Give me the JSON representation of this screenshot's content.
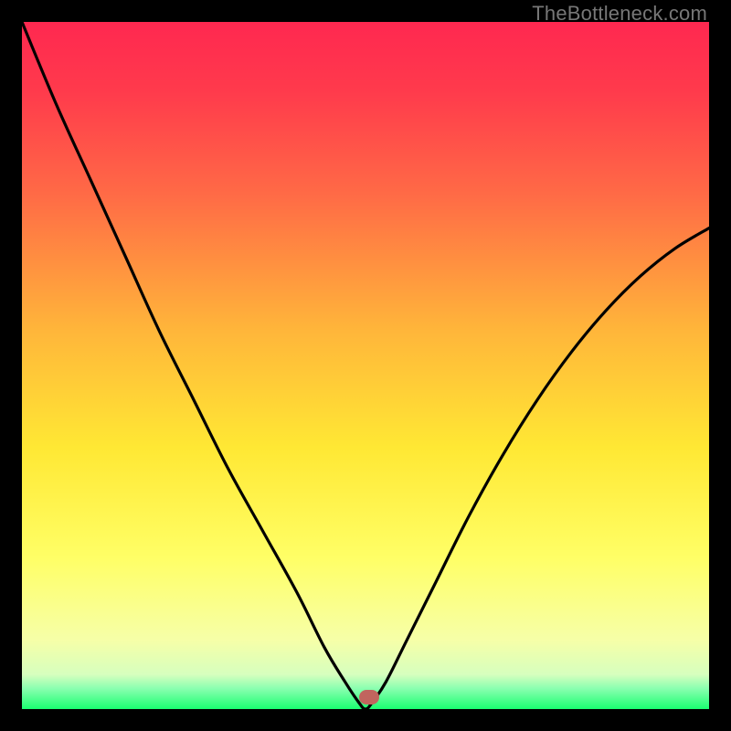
{
  "watermark": "TheBottleneck.com",
  "chart_data": {
    "type": "line",
    "title": "",
    "xlabel": "",
    "ylabel": "",
    "xlim": [
      0,
      100
    ],
    "ylim": [
      0,
      100
    ],
    "background_gradient": [
      "#ff2850",
      "#ff7840",
      "#ffd033",
      "#ffff66",
      "#f8ffb8",
      "#2aff72"
    ],
    "series": [
      {
        "name": "bottleneck-curve",
        "x": [
          0,
          5,
          10,
          15,
          20,
          25,
          30,
          35,
          40,
          44,
          47,
          49,
          50,
          51,
          53,
          56,
          60,
          65,
          70,
          75,
          80,
          85,
          90,
          95,
          100
        ],
        "y": [
          100,
          88,
          77,
          66,
          55,
          45,
          35,
          26,
          17,
          9,
          4,
          1,
          0,
          1,
          4,
          10,
          18,
          28,
          37,
          45,
          52,
          58,
          63,
          67,
          70
        ]
      }
    ],
    "marker": {
      "x_pct": 50.5,
      "y_from_top_pct": 98.3
    }
  }
}
